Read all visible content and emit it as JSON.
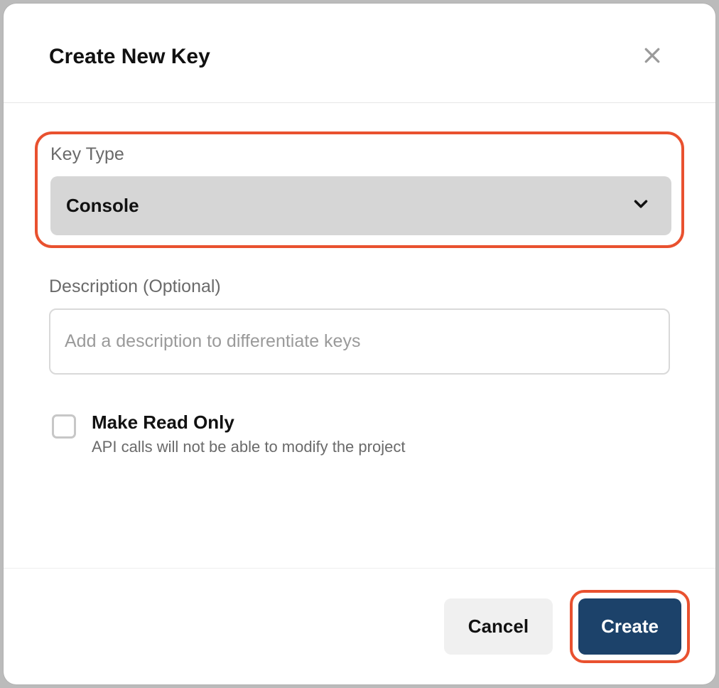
{
  "modal": {
    "title": "Create New Key",
    "keyType": {
      "label": "Key Type",
      "value": "Console"
    },
    "description": {
      "label": "Description (Optional)",
      "placeholder": "Add a description to differentiate keys",
      "value": ""
    },
    "readOnly": {
      "label": "Make Read Only",
      "hint": "API calls will not be able to modify the project",
      "checked": false
    },
    "buttons": {
      "cancel": "Cancel",
      "create": "Create"
    }
  }
}
